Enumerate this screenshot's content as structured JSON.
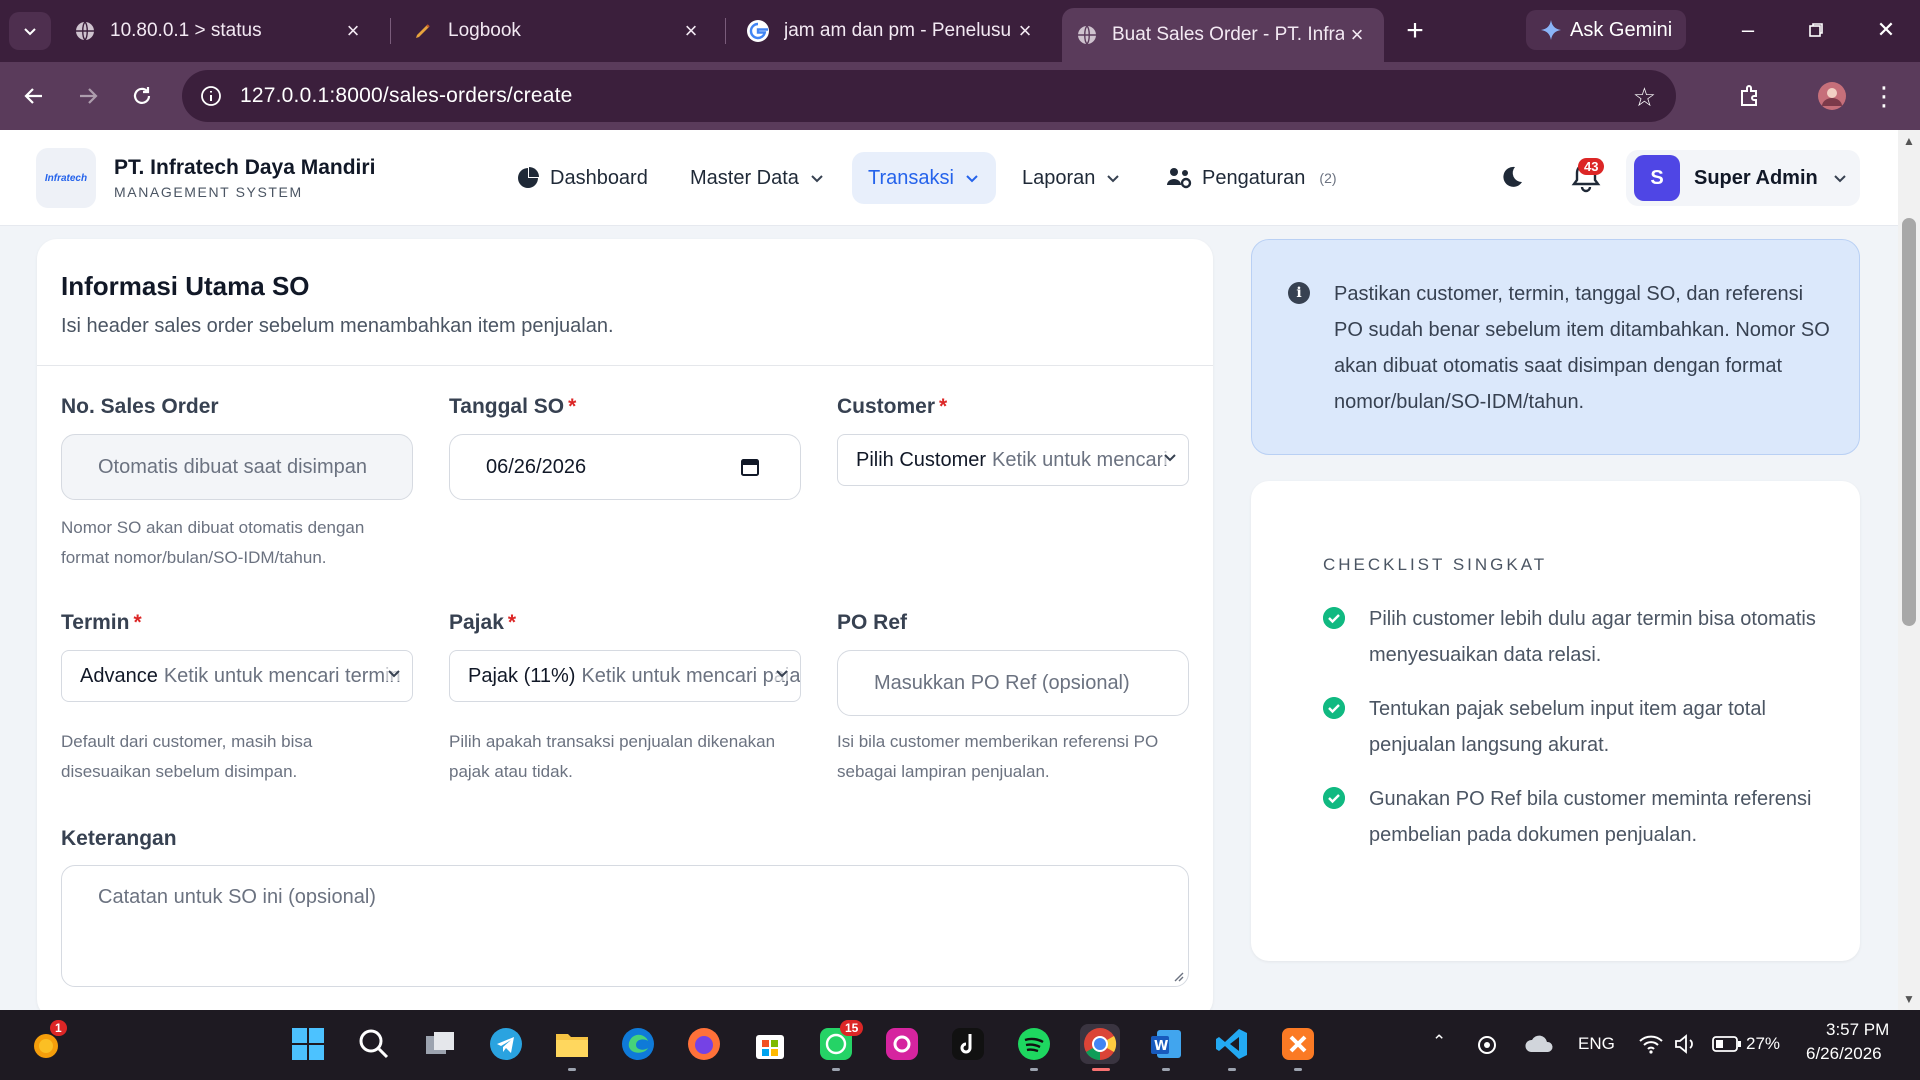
{
  "browser": {
    "tabs": [
      {
        "label": "10.80.0.1 > status",
        "icon": "globe-icon"
      },
      {
        "label": "Logbook",
        "icon": "pen-icon"
      },
      {
        "label": "jam am dan pm - Penelusuran",
        "icon": "google-icon"
      },
      {
        "label": "Buat Sales Order - PT. Infratech",
        "icon": "globe-icon",
        "active": true
      }
    ],
    "gemini_label": "Ask Gemini",
    "url": "127.0.0.1:8000/sales-orders/create"
  },
  "header": {
    "logo_text": "Infratech",
    "brand_name": "PT. Infratech Daya Mandiri",
    "brand_sub": "MANAGEMENT SYSTEM",
    "nav": {
      "dashboard": "Dashboard",
      "master_data": "Master Data",
      "transaksi": "Transaksi",
      "laporan": "Laporan",
      "pengaturan": "Pengaturan",
      "pengaturan_count": "(2)"
    },
    "notification_count": "43",
    "user_initial": "S",
    "user_name": "Super Admin"
  },
  "form": {
    "title": "Informasi Utama SO",
    "subtitle": "Isi header sales order sebelum menambahkan item penjualan.",
    "no_so": {
      "label": "No. Sales Order",
      "placeholder": "Otomatis dibuat saat disimpan",
      "help": "Nomor SO akan dibuat otomatis dengan format nomor/bulan/SO-IDM/tahun."
    },
    "tanggal": {
      "label": "Tanggal SO",
      "required": "*",
      "value": "06/26/2026"
    },
    "customer": {
      "label": "Customer",
      "required": "*",
      "value": "Pilih Customer",
      "placeholder": "Ketik untuk mencari"
    },
    "termin": {
      "label": "Termin",
      "required": "*",
      "value": "Advance",
      "placeholder": "Ketik untuk mencari termin",
      "help": "Default dari customer, masih bisa disesuaikan sebelum disimpan."
    },
    "pajak": {
      "label": "Pajak",
      "required": "*",
      "value": "Pajak (11%)",
      "placeholder": "Ketik untuk mencari pajak",
      "help": "Pilih apakah transaksi penjualan dikenakan pajak atau tidak."
    },
    "po_ref": {
      "label": "PO Ref",
      "placeholder": "Masukkan PO Ref (opsional)",
      "help": "Isi bila customer memberikan referensi PO sebagai lampiran penjualan."
    },
    "keterangan": {
      "label": "Keterangan",
      "placeholder": "Catatan untuk SO ini (opsional)"
    }
  },
  "info": {
    "text": "Pastikan customer, termin, tanggal SO, dan referensi PO sudah benar sebelum item ditambahkan. Nomor SO akan dibuat otomatis saat disimpan dengan format nomor/bulan/SO-IDM/tahun."
  },
  "checklist": {
    "title": "CHECKLIST SINGKAT",
    "items": [
      "Pilih customer lebih dulu agar termin bisa otomatis menyesuaikan data relasi.",
      "Tentukan pajak sebelum input item agar total penjualan langsung akurat.",
      "Gunakan PO Ref bila customer meminta referensi pembelian pada dokumen penjualan."
    ]
  },
  "taskbar": {
    "notif_badge": "1",
    "whatsapp_badge": "15",
    "lang": "ENG",
    "battery": "27%",
    "time": "3:57 PM",
    "date": "6/26/2026"
  },
  "colors": {
    "accent": "#2563eb",
    "danger": "#dc2626",
    "success": "#10b981",
    "info_bg": "#dbe8fb",
    "browser_frame": "#3b1f3c"
  }
}
